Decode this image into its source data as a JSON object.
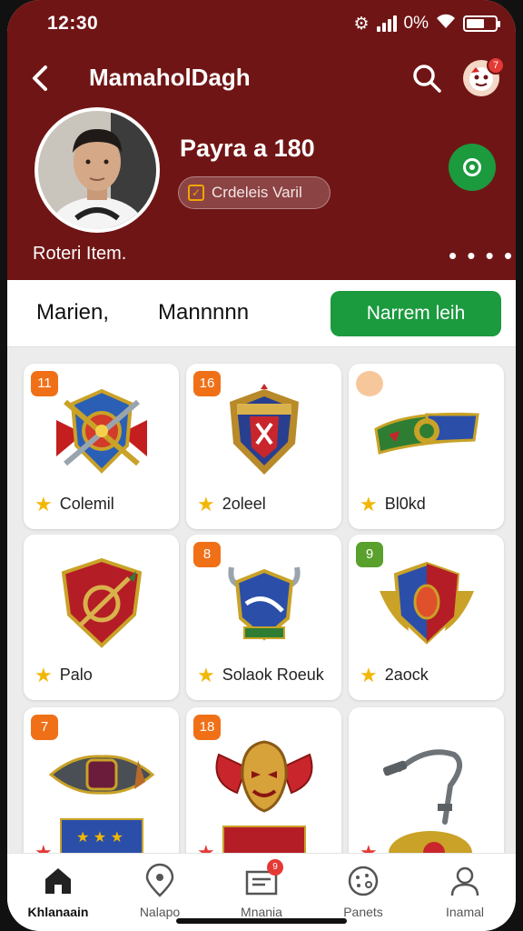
{
  "status": {
    "time": "12:30",
    "battery_text": "0%"
  },
  "topbar": {
    "title": "MamaholDagh",
    "notif_count": "7"
  },
  "profile": {
    "name": "Payra a 180",
    "rank": "Crdeleis Varil",
    "subtitle": "Roteri Item."
  },
  "tabs": {
    "tab1": "Marien,",
    "tab2": "Mannnnn",
    "cta": "Narrem leih"
  },
  "cards": [
    {
      "num": "11",
      "label": "Colemil"
    },
    {
      "num": "16",
      "label": "2oleel"
    },
    {
      "num": "",
      "label": "Bl0kd"
    },
    {
      "num": "",
      "label": "Palo"
    },
    {
      "num": "8",
      "label": "Solaok Roeuk"
    },
    {
      "num": "9",
      "label": "2aock"
    },
    {
      "num": "7",
      "label": ""
    },
    {
      "num": "18",
      "label": ""
    },
    {
      "num": "",
      "label": ""
    }
  ],
  "nav": {
    "items": [
      {
        "label": "Khlanaain",
        "icon": "home-icon"
      },
      {
        "label": "Nalapo",
        "icon": "map-pin-icon"
      },
      {
        "label": "Mnania",
        "icon": "inbox-icon",
        "badge": "9"
      },
      {
        "label": "Panets",
        "icon": "palette-icon"
      },
      {
        "label": "Inamal",
        "icon": "person-icon"
      }
    ]
  },
  "colors": {
    "header": "#701515",
    "accent_green": "#1b9a3e",
    "badge_orange": "#f07018",
    "badge_green": "#5aa02c",
    "star": "#f2b705"
  }
}
